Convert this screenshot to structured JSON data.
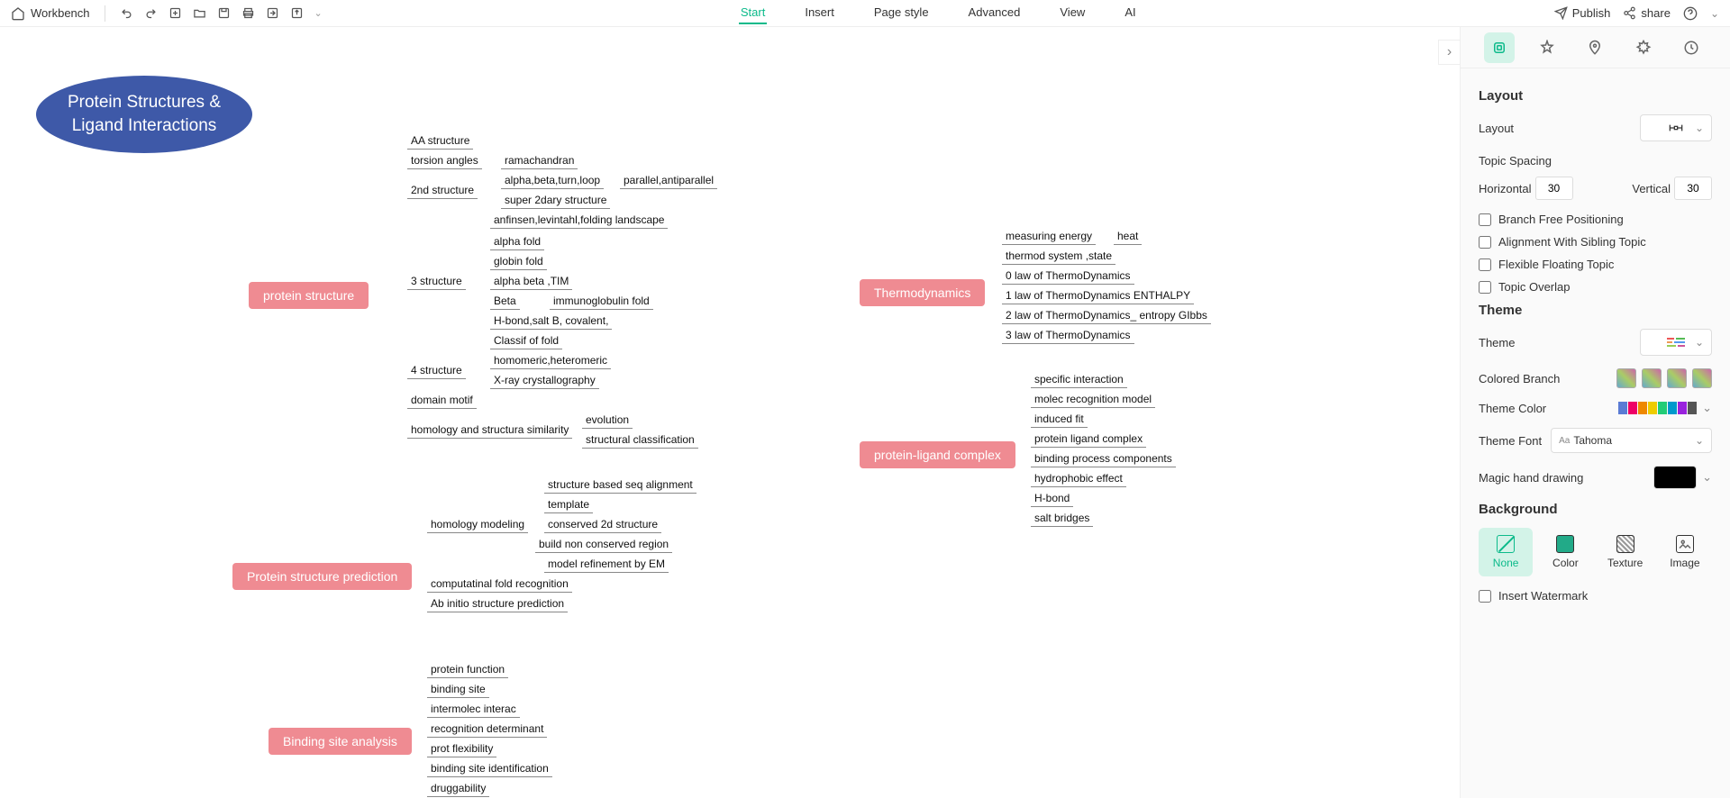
{
  "toolbar": {
    "workbench": "Workbench",
    "menu": [
      "Start",
      "Insert",
      "Page style",
      "Advanced",
      "View",
      "AI"
    ],
    "active_menu": "Start",
    "publish": "Publish",
    "share": "share"
  },
  "mindmap": {
    "title": "Protein Structures & Ligand Interactions",
    "branches": [
      {
        "label": "protein structure",
        "children": [
          {
            "label": "AA structure"
          },
          {
            "label": "torsion angles",
            "children": [
              {
                "label": "ramachandran"
              }
            ]
          },
          {
            "label": "2nd structure",
            "children": [
              {
                "label": "alpha,beta,turn,loop",
                "children": [
                  {
                    "label": "parallel,antiparallel"
                  }
                ]
              },
              {
                "label": "super 2dary structure"
              }
            ]
          },
          {
            "label": "3 structure",
            "children": [
              {
                "label": "anfinsen,levintahl,folding landscape"
              },
              {
                "label": "alpha fold"
              },
              {
                "label": "globin fold"
              },
              {
                "label": "alpha beta ,TIM"
              },
              {
                "label": "Beta",
                "children": [
                  {
                    "label": "immunoglobulin fold"
                  }
                ]
              },
              {
                "label": "H-bond,salt B, covalent,"
              },
              {
                "label": "Classif of fold"
              }
            ]
          },
          {
            "label": "4 structure",
            "children": [
              {
                "label": "homomeric,heteromeric"
              },
              {
                "label": "X-ray crystallography"
              }
            ]
          },
          {
            "label": "domain motif"
          },
          {
            "label": "homology and structura similarity",
            "children": [
              {
                "label": "evolution"
              },
              {
                "label": "structural classification"
              }
            ]
          }
        ]
      },
      {
        "label": "Protein structure prediction",
        "children": [
          {
            "label": "homology modeling",
            "children": [
              {
                "label": "structure based seq alignment"
              },
              {
                "label": "template"
              },
              {
                "label": "conserved 2d structure"
              },
              {
                "label": "build non conserved region"
              },
              {
                "label": "model refinement by EM"
              }
            ]
          },
          {
            "label": "computatinal fold recognition"
          },
          {
            "label": "Ab initio structure prediction"
          }
        ]
      },
      {
        "label": "Binding site analysis",
        "children": [
          {
            "label": "protein function"
          },
          {
            "label": "binding site"
          },
          {
            "label": "intermolec interac"
          },
          {
            "label": "recognition determinant"
          },
          {
            "label": "prot flexibility"
          },
          {
            "label": "binding site identification"
          },
          {
            "label": "druggability"
          }
        ]
      },
      {
        "label": "Thermodynamics",
        "children": [
          {
            "label": "measuring energy",
            "children": [
              {
                "label": "heat"
              }
            ]
          },
          {
            "label": "thermod system ,state"
          },
          {
            "label": "0 law of ThermoDynamics"
          },
          {
            "label": "1 law of ThermoDynamics ENTHALPY"
          },
          {
            "label": "2 law of ThermoDynamics_ entropy GIbbs"
          },
          {
            "label": "3 law of ThermoDynamics"
          }
        ]
      },
      {
        "label": "protein-ligand complex",
        "children": [
          {
            "label": "specific interaction"
          },
          {
            "label": "molec recognition model"
          },
          {
            "label": "induced fit"
          },
          {
            "label": "protein ligand complex"
          },
          {
            "label": "binding process components"
          },
          {
            "label": "hydrophobic effect"
          },
          {
            "label": "H-bond"
          },
          {
            "label": "salt bridges"
          }
        ]
      }
    ]
  },
  "panel": {
    "sections": {
      "layout": {
        "title": "Layout",
        "layout_label": "Layout",
        "topic_spacing": "Topic Spacing",
        "horizontal": "Horizontal",
        "horizontal_val": "30",
        "vertical": "Vertical",
        "vertical_val": "30",
        "branch_free": "Branch Free Positioning",
        "align_sibling": "Alignment With Sibling Topic",
        "flex_float": "Flexible Floating Topic",
        "topic_overlap": "Topic Overlap"
      },
      "theme": {
        "title": "Theme",
        "theme_label": "Theme",
        "colored_branch": "Colored Branch",
        "theme_color": "Theme Color",
        "theme_font": "Theme Font",
        "font_value": "Tahoma",
        "magic_hand": "Magic hand drawing"
      },
      "background": {
        "title": "Background",
        "options": [
          "None",
          "Color",
          "Texture",
          "Image"
        ],
        "active": "None",
        "insert_watermark": "Insert Watermark"
      }
    }
  }
}
